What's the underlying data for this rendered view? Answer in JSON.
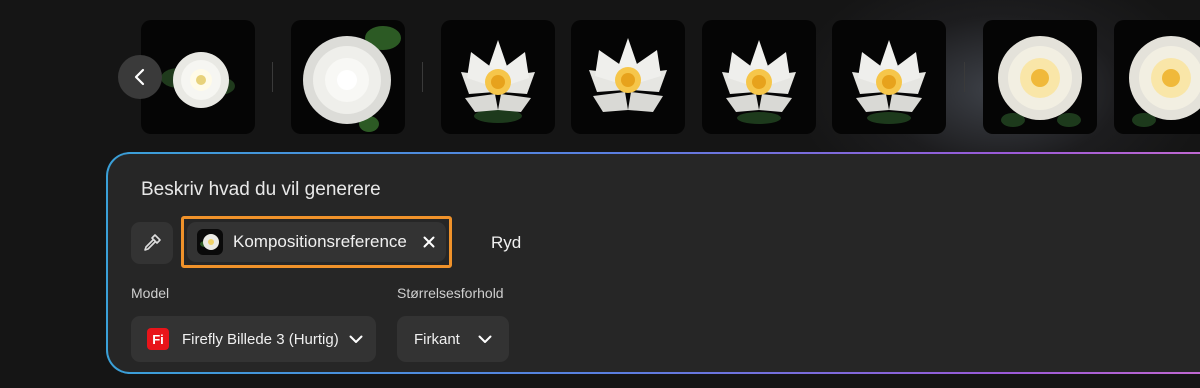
{
  "carousel": {
    "prev_label": "‹",
    "thumbnails": [
      {
        "name": "thumb-camellia-small",
        "variant": "camellia-small"
      },
      {
        "name": "thumb-camellia-large",
        "variant": "camellia-large"
      },
      {
        "name": "thumb-lotus-1",
        "variant": "lotus"
      },
      {
        "name": "thumb-lotus-2",
        "variant": "lotus"
      },
      {
        "name": "thumb-lotus-3",
        "variant": "lotus"
      },
      {
        "name": "thumb-lotus-4",
        "variant": "lotus"
      },
      {
        "name": "thumb-camellia-yellow-1",
        "variant": "camellia-yellow"
      },
      {
        "name": "thumb-camellia-yellow-2",
        "variant": "camellia-yellow"
      }
    ]
  },
  "prompt": {
    "placeholder": "Beskriv hvad du vil generere",
    "reference_chip_label": "Kompositionsreference",
    "clear_label": "Ryd"
  },
  "settings": {
    "model_label": "Model",
    "model_badge": "Fi",
    "model_value": "Firefly Billede 3 (Hurtig)",
    "aspect_label": "Størrelsesforhold",
    "aspect_value": "Firkant"
  },
  "colors": {
    "highlight": "#f0922a",
    "brand_red": "#e8141a",
    "panel_border_start": "#3aa0d8",
    "panel_border_end": "#c46ad0"
  }
}
